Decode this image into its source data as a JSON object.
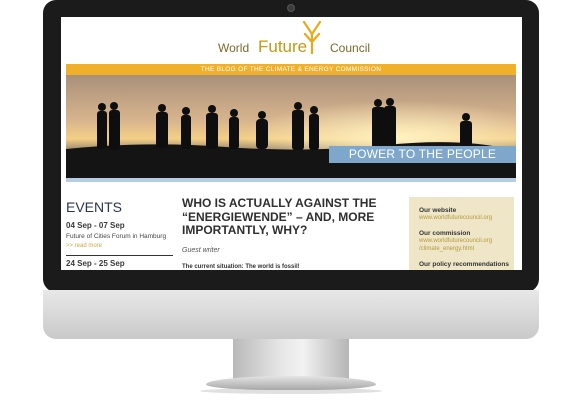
{
  "site": {
    "logo": {
      "word1": "World",
      "word2": "Future",
      "word3": "Council"
    },
    "tagline": "THE BLOG OF THE CLIMATE & ENERGY COMMISSION",
    "hero_caption": "POWER TO THE PEOPLE"
  },
  "events": {
    "title": "EVENTS",
    "items": [
      {
        "date": "04 Sep - 07 Sep",
        "name": "Future of Cities Forum in Hamburg",
        "more": ">> read more"
      },
      {
        "date": "24 Sep - 25 Sep",
        "name": "",
        "more": ""
      }
    ]
  },
  "article": {
    "title": "WHO IS ACTUALLY AGAINST THE “ENERGIEWENDE” – AND, MORE IMPORTANTLY, WHY?",
    "byline": "Guest writer",
    "lead": "The current situation: The world is fossil!"
  },
  "sidebar": {
    "groups": [
      {
        "heading": "Our website",
        "links": [
          "www.worldfuturecouncil.org"
        ]
      },
      {
        "heading": "Our commission",
        "links": [
          "www.worldfuturecouncil.org",
          "/climate_energy.html"
        ]
      },
      {
        "heading": "Our policy recommendations",
        "links": []
      }
    ]
  },
  "colors": {
    "accent_orange": "#f1b02b",
    "caption_blue": "#7fa7cc",
    "sidebar_bg": "#eee6c6",
    "bezel": "#1b1b1b"
  }
}
